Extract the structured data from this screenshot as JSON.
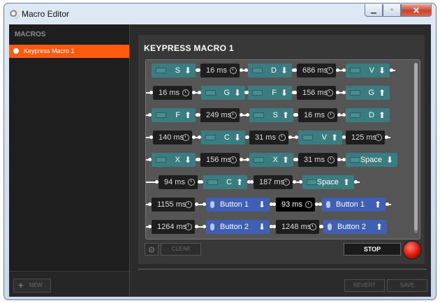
{
  "window": {
    "title": "Macro Editor"
  },
  "sidebar": {
    "heading": "MACROS",
    "selected_item": "Keypress Macro 1",
    "new_label": "NEW"
  },
  "editor": {
    "title": "KEYPRESS MACRO 1",
    "clear_label": "CLEAR",
    "stop_label": "STOP"
  },
  "footer": {
    "revert_label": "REVERT",
    "save_label": "SAVE"
  },
  "colors": {
    "accent": "#ff5a0f",
    "key_event": "#3a7d80",
    "mouse_event": "#3e5fb3",
    "delay": "#1e1e1e",
    "record": "#d80f00"
  },
  "events": [
    {
      "type": "key",
      "label": "S",
      "dir": "down"
    },
    {
      "type": "delay",
      "label": "16 ms"
    },
    {
      "type": "key",
      "label": "D",
      "dir": "down"
    },
    {
      "type": "delay",
      "label": "686 ms"
    },
    {
      "type": "key",
      "label": "V",
      "dir": "down"
    },
    {
      "type": "delay",
      "label": "16 ms"
    },
    {
      "type": "key",
      "label": "G",
      "dir": "down"
    },
    {
      "type": "key",
      "label": "F",
      "dir": "down"
    },
    {
      "type": "delay",
      "label": "156 ms"
    },
    {
      "type": "key",
      "label": "G",
      "dir": "up"
    },
    {
      "type": "key",
      "label": "F",
      "dir": "up"
    },
    {
      "type": "delay",
      "label": "249 ms"
    },
    {
      "type": "key",
      "label": "S",
      "dir": "up"
    },
    {
      "type": "delay",
      "label": "16 ms"
    },
    {
      "type": "key",
      "label": "D",
      "dir": "up"
    },
    {
      "type": "delay",
      "label": "140 ms"
    },
    {
      "type": "key",
      "label": "C",
      "dir": "down"
    },
    {
      "type": "delay",
      "label": "31 ms"
    },
    {
      "type": "key",
      "label": "V",
      "dir": "up"
    },
    {
      "type": "delay",
      "label": "125 ms"
    },
    {
      "type": "key",
      "label": "X",
      "dir": "down"
    },
    {
      "type": "delay",
      "label": "156 ms"
    },
    {
      "type": "key",
      "label": "X",
      "dir": "up"
    },
    {
      "type": "delay",
      "label": "31 ms"
    },
    {
      "type": "key",
      "label": "Space",
      "dir": "down"
    },
    {
      "type": "delay",
      "label": "94 ms"
    },
    {
      "type": "key",
      "label": "C",
      "dir": "up"
    },
    {
      "type": "delay",
      "label": "187 ms"
    },
    {
      "type": "key",
      "label": "Space",
      "dir": "up"
    },
    {
      "type": "delay",
      "label": "1155 ms"
    },
    {
      "type": "mouse",
      "label": "Button 1",
      "dir": "down"
    },
    {
      "type": "delay",
      "label": "93 ms",
      "highlight": true
    },
    {
      "type": "mouse",
      "label": "Button 1",
      "dir": "up"
    },
    {
      "type": "delay",
      "label": "1264 ms"
    },
    {
      "type": "mouse",
      "label": "Button 2",
      "dir": "down"
    },
    {
      "type": "delay",
      "label": "1248 ms"
    },
    {
      "type": "mouse",
      "label": "Button 2",
      "dir": "up"
    }
  ]
}
